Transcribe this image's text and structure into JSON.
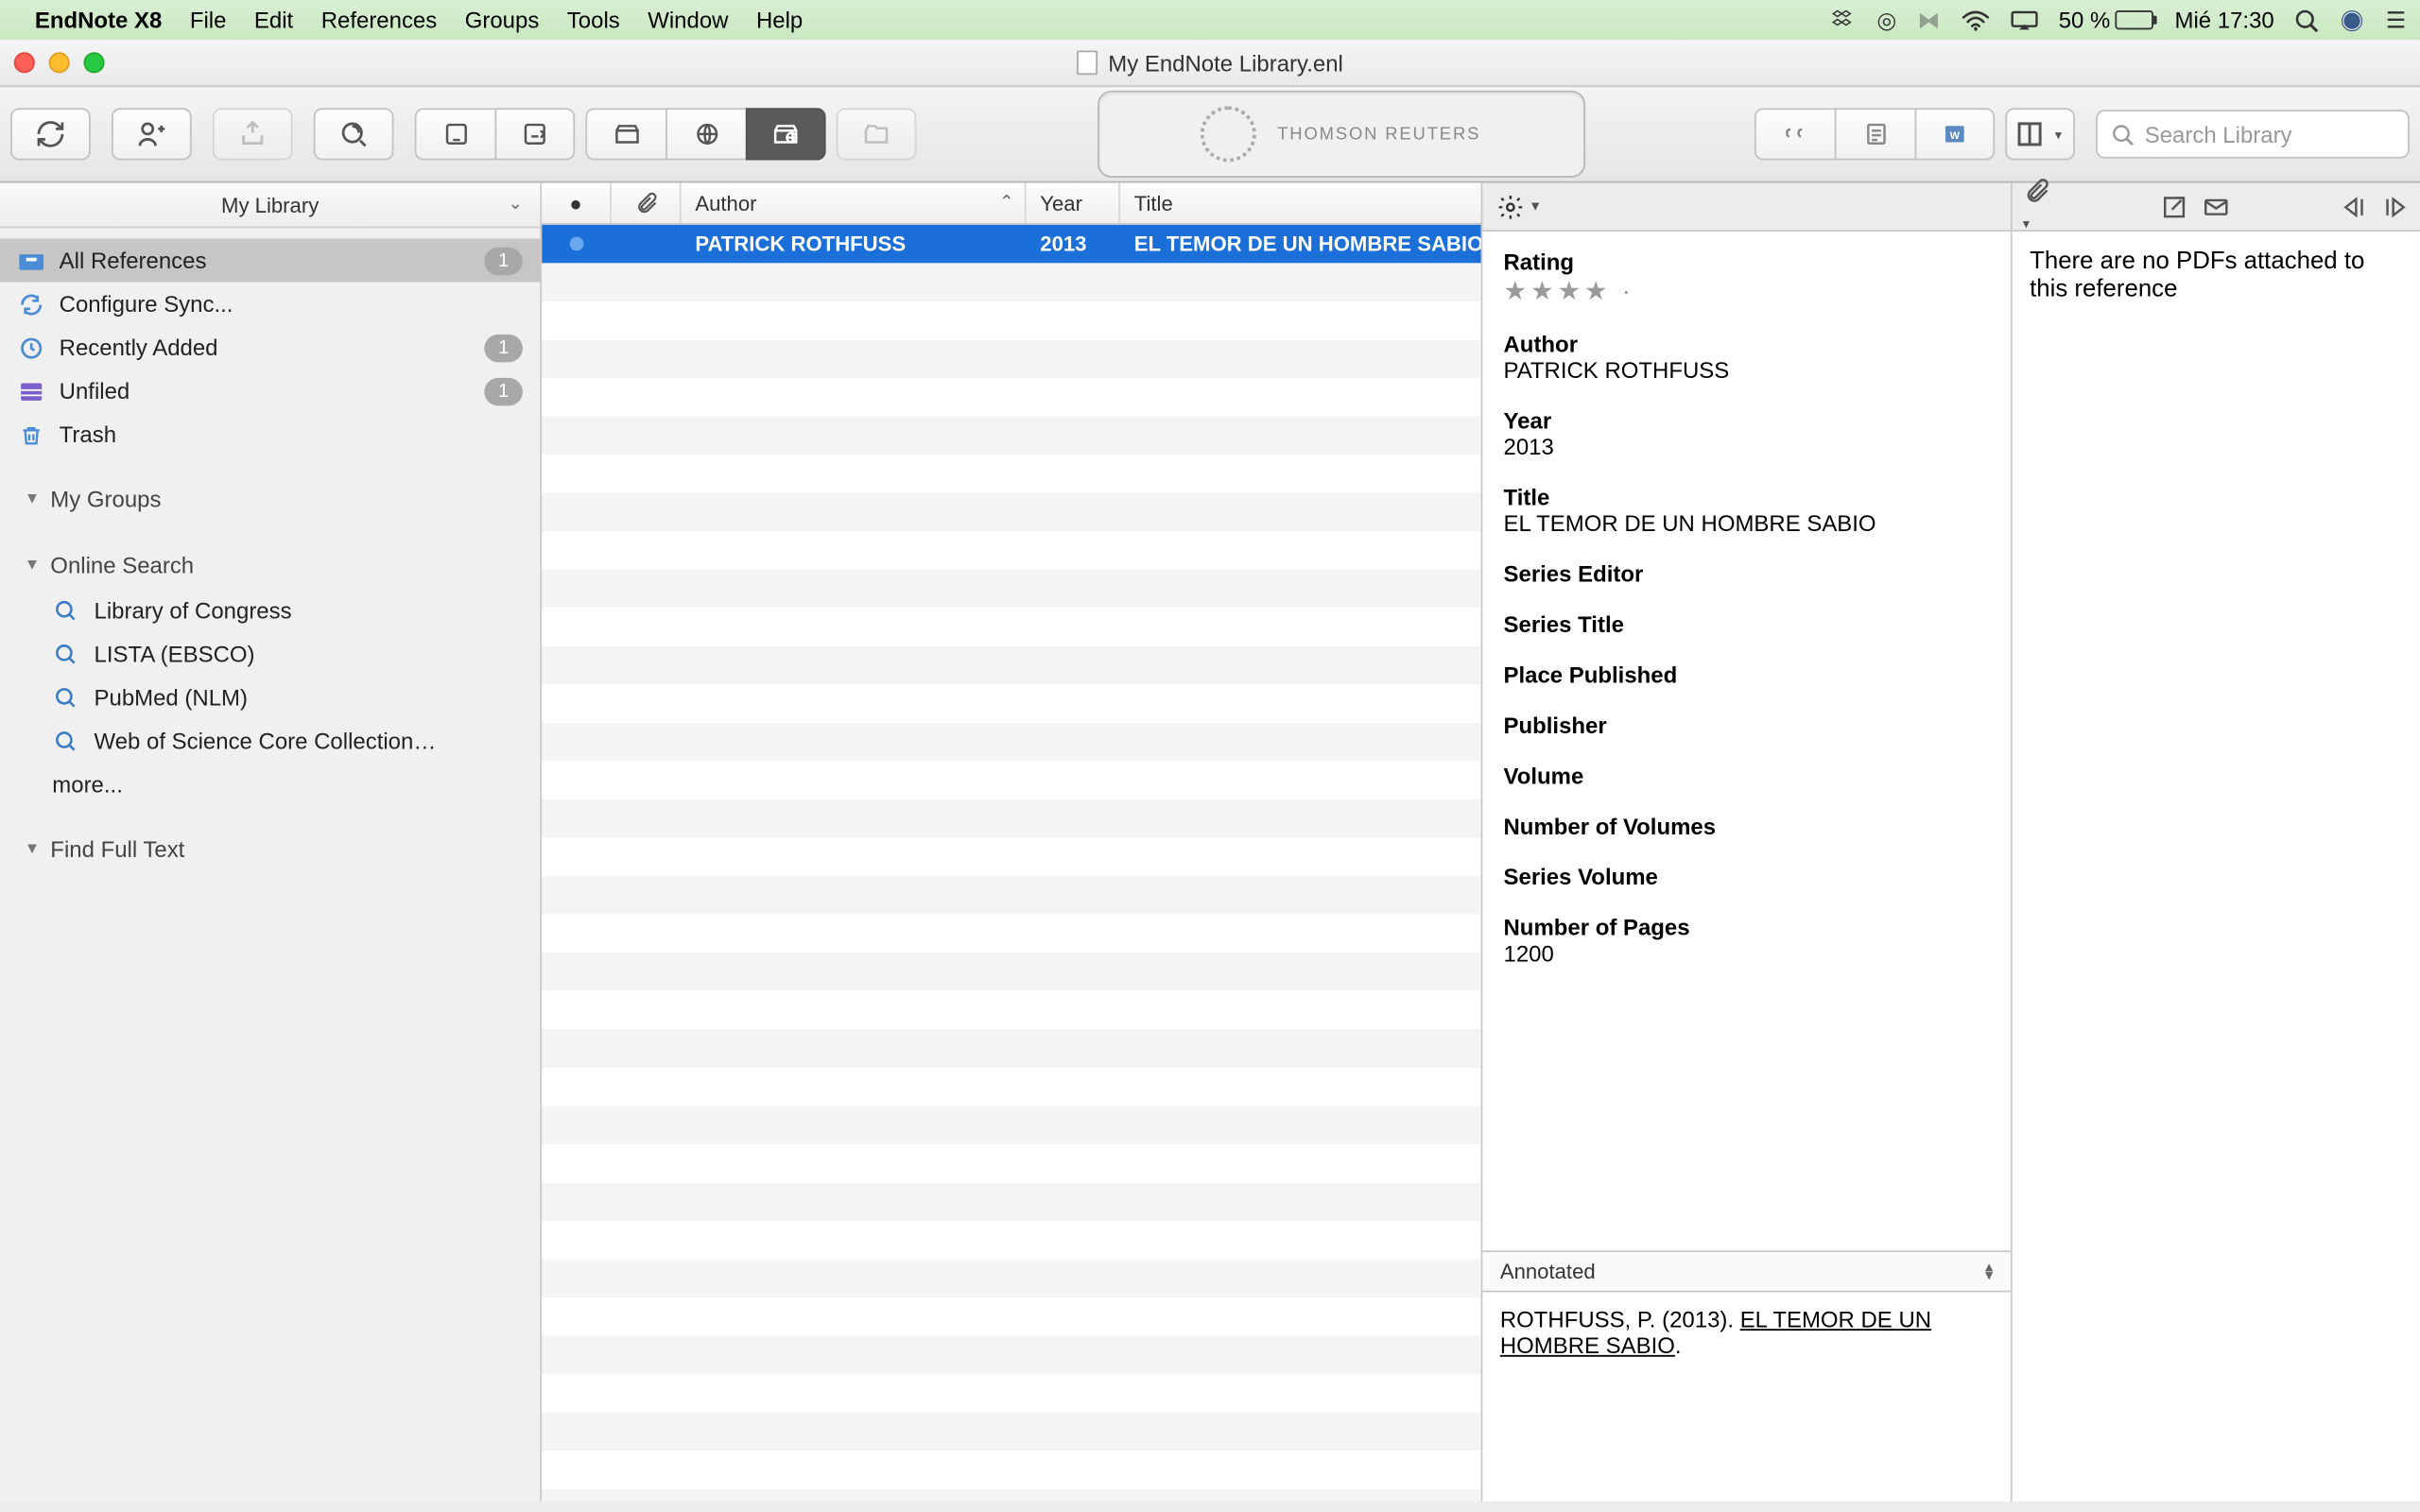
{
  "menubar": {
    "app": "EndNote X8",
    "items": [
      "File",
      "Edit",
      "References",
      "Groups",
      "Tools",
      "Window",
      "Help"
    ],
    "battery": "50 %",
    "datetime": "Mié 17:30"
  },
  "window": {
    "title": "My EndNote Library.enl"
  },
  "toolbar": {
    "logo_text": "THOMSON REUTERS",
    "search_placeholder": "Search Library"
  },
  "sidebar": {
    "header": "My Library",
    "items": [
      {
        "label": "All References",
        "badge": "1",
        "icon": "drawer"
      },
      {
        "label": "Configure Sync...",
        "badge": null,
        "icon": "sync"
      },
      {
        "label": "Recently Added",
        "badge": "1",
        "icon": "clock"
      },
      {
        "label": "Unfiled",
        "badge": "1",
        "icon": "stack"
      },
      {
        "label": "Trash",
        "badge": null,
        "icon": "trash"
      }
    ],
    "groups_label": "My Groups",
    "online_label": "Online Search",
    "online_items": [
      "Library of Congress",
      "LISTA (EBSCO)",
      "PubMed (NLM)",
      "Web of Science Core Collection…"
    ],
    "more_label": "more...",
    "fft_label": "Find Full Text"
  },
  "reflist": {
    "columns": {
      "author": "Author",
      "year": "Year",
      "title": "Title"
    },
    "rows": [
      {
        "author": "PATRICK ROTHFUSS",
        "year": "2013",
        "title": "EL TEMOR DE UN HOMBRE SABIO"
      }
    ]
  },
  "detail": {
    "fields": [
      {
        "label": "Rating",
        "value": "★★★★ ·",
        "stars": true
      },
      {
        "label": "Author",
        "value": "PATRICK ROTHFUSS"
      },
      {
        "label": "Year",
        "value": "2013"
      },
      {
        "label": "Title",
        "value": "EL TEMOR DE UN HOMBRE SABIO"
      },
      {
        "label": "Series Editor",
        "value": ""
      },
      {
        "label": "Series Title",
        "value": ""
      },
      {
        "label": "Place Published",
        "value": ""
      },
      {
        "label": "Publisher",
        "value": ""
      },
      {
        "label": "Volume",
        "value": ""
      },
      {
        "label": "Number of Volumes",
        "value": ""
      },
      {
        "label": "Series Volume",
        "value": ""
      },
      {
        "label": "Number of Pages",
        "value": "1200"
      }
    ],
    "style": "Annotated",
    "citation_prefix": "ROTHFUSS, P. (2013). ",
    "citation_title": "EL TEMOR DE UN HOMBRE SABIO",
    "citation_suffix": "."
  },
  "pdf": {
    "message": "There are no PDFs attached to this reference"
  }
}
